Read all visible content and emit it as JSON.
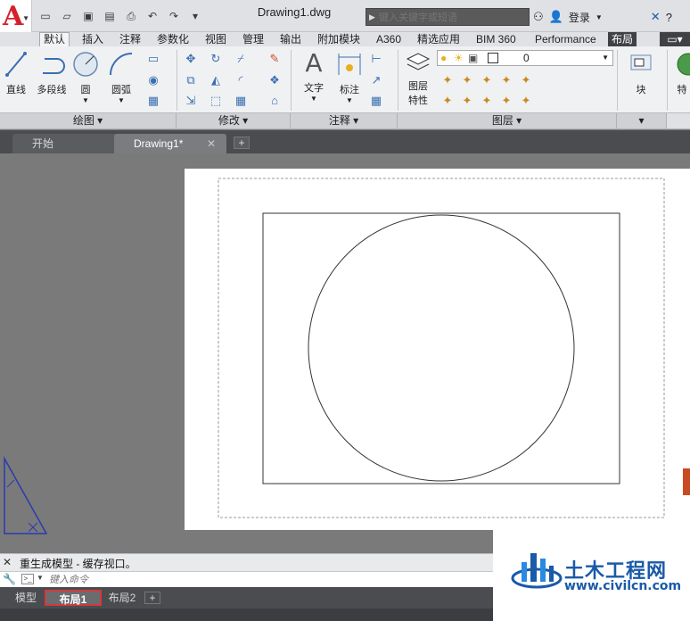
{
  "app": {
    "logo_letter": "A",
    "title": "Drawing1.dwg"
  },
  "quick_access": [
    "new-icon",
    "open-icon",
    "save-icon",
    "saveas-icon",
    "plot-icon",
    "undo-icon",
    "redo-icon",
    "customize-icon"
  ],
  "search": {
    "placeholder": "键入关键字或短语"
  },
  "account": {
    "login": "登录"
  },
  "ribbon_tabs": [
    "默认",
    "插入",
    "注释",
    "参数化",
    "视图",
    "管理",
    "输出",
    "附加模块",
    "A360",
    "精选应用",
    "BIM 360",
    "Performance",
    "布局"
  ],
  "ribbon_tools": {
    "line": "直线",
    "polyline": "多段线",
    "circle": "圆",
    "arc": "圆弧",
    "text": "文字",
    "dimension": "标注",
    "layer_props": [
      "图层",
      "特性"
    ],
    "block": "块",
    "properties_partial": "特"
  },
  "layer": {
    "current": "0"
  },
  "panels": {
    "draw": "绘图",
    "modify": "修改",
    "annotation": "注释",
    "layers": "图层"
  },
  "doc_tabs": {
    "start": "开始",
    "drawing": "Drawing1*"
  },
  "command": {
    "history": "重生成模型 - 缓存视口。",
    "placeholder": "键入命令"
  },
  "layout_tabs": {
    "model": "模型",
    "layout1": "布局1",
    "layout2": "布局2"
  },
  "watermark": {
    "name": "土木工程网",
    "url": "www.civilcn.com"
  },
  "colors": {
    "logo_red": "#d6202a",
    "highlight": "#d23a3a",
    "brand_blue": "#1a5aa8"
  }
}
